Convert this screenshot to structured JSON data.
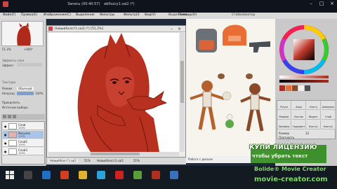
{
  "titlebar": {
    "doc_title": "Запись (00:40:57)",
    "app_title": "ab0sxcy1.sai2 (*)"
  },
  "menu": {
    "items": [
      "Файл(F)",
      "Правка(E)",
      "Изображение(C)",
      "Выделение",
      "Фильтры",
      "Фильтр(I)",
      "Вид(V)",
      "Помощь(H)"
    ]
  },
  "toolbar": {
    "zoom": "51.2%",
    "angle": "+000°",
    "mode_label": "Выделение",
    "smoothing_label": "Стабилизатор"
  },
  "left_panel": {
    "zoom_value": "51.2%",
    "angle_value": "+000°",
    "effects_label": "Эффекты слоя",
    "effect_label": "Эффект",
    "layer_section": "Текстура",
    "blend_label": "Режим",
    "blend_value": "Обычный",
    "opacity_label": "Непрозр.",
    "opacity_value": "100%",
    "protect_label": "Прикрепить",
    "source_label": "Источник выбора",
    "layers": [
      {
        "name": "Слой",
        "mode": "Обычный",
        "opacity": "100%",
        "selected": false
      },
      {
        "name": "Рисунок",
        "mode": "Обычный",
        "opacity": "100%",
        "selected": true
      },
      {
        "name": "Слой2",
        "mode": "Обычный",
        "opacity": "100%",
        "selected": false
      },
      {
        "name": "Слой3",
        "mode": "Обычный",
        "opacity": "100%",
        "selected": false
      }
    ]
  },
  "document": {
    "title": "НовыйХолст1.sai2 (*) [51.2%]",
    "tabs": [
      "НовыйХолст1.sai2",
      "51%",
      "НовыйХолст2.sai2",
      "51%"
    ]
  },
  "status": {
    "text": "Работа с диском"
  },
  "right_panel": {
    "brushes": [
      "Ручка",
      "Аэро",
      "Кисть",
      "Акварель",
      "Маркер",
      "Ластик",
      "Выдел.",
      "Слой",
      "Заливка",
      "Градиент",
      "Кисть1",
      "Кисть2"
    ],
    "size_label": "Размер",
    "density_label": "Плотность",
    "size_value": "12"
  },
  "watermark": {
    "line1": "КУПИ ЛИЦЕНЗИЮ",
    "line2": "чтобы убрать текст",
    "line3": "Bolide® Movie Creator",
    "line4": "movie-creator.com"
  },
  "colors": {
    "lineart": "#b02a1c",
    "accent": "#2f8a1c"
  }
}
